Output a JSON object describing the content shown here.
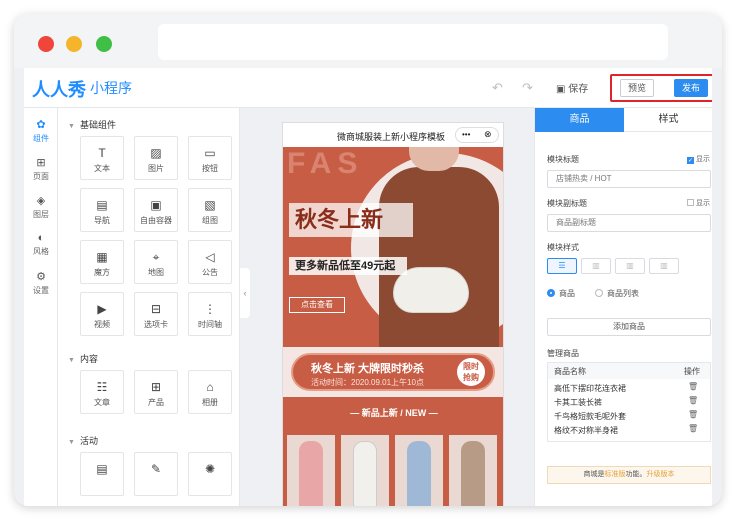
{
  "app": {
    "logo": "人人秀",
    "subtitle": "小程序"
  },
  "toolbar": {
    "save": "保存",
    "preview": "预览",
    "publish": "发布"
  },
  "rail": [
    {
      "label": "组件",
      "icon": "puzzle-icon"
    },
    {
      "label": "页面",
      "icon": "page-plus-icon"
    },
    {
      "label": "图层",
      "icon": "layers-icon"
    },
    {
      "label": "风格",
      "icon": "palette-icon"
    },
    {
      "label": "设置",
      "icon": "gear-icon"
    }
  ],
  "sections": {
    "basic": "基础组件",
    "content": "内容",
    "activity": "活动"
  },
  "basic_components": [
    "文本",
    "图片",
    "按钮",
    "导航",
    "自由容器",
    "组图",
    "魔方",
    "地图",
    "公告",
    "视频",
    "选项卡",
    "时间轴"
  ],
  "content_components": [
    "文章",
    "产品",
    "相册"
  ],
  "phone": {
    "title": "微商城服装上新小程序模板",
    "capsule_more": "•••",
    "banner_bg_text": "FAS",
    "banner_title": "秋冬上新",
    "banner_sub": "更多新品低至49元起",
    "banner_button": "点击查看",
    "promo_title": "秋冬上新  大牌限时秒杀",
    "promo_time": "活动时间：2020.09.01上午10点",
    "promo_badge_1": "限时",
    "promo_badge_2": "抢购",
    "new_header": "—  新品上新 / NEW  —"
  },
  "panel": {
    "tab_goods": "商品",
    "tab_style": "样式",
    "module_title_label": "模块标题",
    "show": "显示",
    "module_title_value": "店铺热卖 / HOT",
    "module_subtitle_label": "模块副标题",
    "module_subtitle_placeholder": "商品副标题",
    "module_style_label": "模块样式",
    "radio_goods": "商品",
    "radio_list": "商品列表",
    "add_goods": "添加商品",
    "manage_label": "管理商品",
    "col_name": "商品名称",
    "col_op": "操作",
    "goods": [
      "高低下摆印花连衣裙",
      "卡其工装长裤",
      "千鸟格短款毛呢外套",
      "格纹不对称半身裙"
    ],
    "notice_prefix": "商城是",
    "notice_link": "标准版",
    "notice_mid": "功能。",
    "notice_upgrade": "升级版本"
  },
  "colors": {
    "accent": "#2d8cf0",
    "brand": "#c85d45",
    "highlight": "#e0242b"
  }
}
